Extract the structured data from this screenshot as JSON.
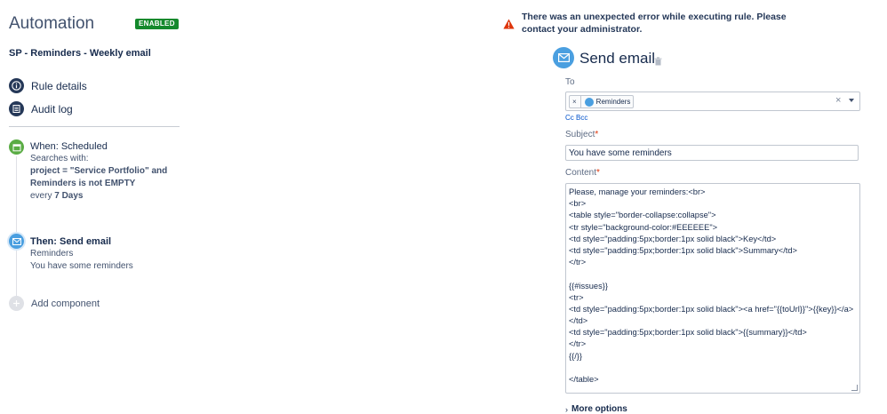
{
  "sidebar": {
    "title": "Automation",
    "status_badge": "ENABLED",
    "rule_name": "SP - Reminders - Weekly email",
    "nav": {
      "rule_details": "Rule details",
      "audit_log": "Audit log"
    },
    "trigger": {
      "title": "When: Scheduled",
      "searches_label": "Searches with:",
      "jql_line1": "project = \"Service Portfolio\" and",
      "jql_line2": "Reminders is not EMPTY",
      "every_prefix": "every",
      "every_value": "7 Days"
    },
    "action": {
      "title": "Then: Send email",
      "line1": "Reminders",
      "line2": "You have some reminders"
    },
    "add_component": "Add component"
  },
  "editor": {
    "error_message": "There was an unexpected error while executing rule. Please contact your administrator.",
    "title": "Send email",
    "to_label": "To",
    "to_recipient": "Reminders",
    "cc_bcc": "Cc Bcc",
    "subject_label": "Subject",
    "subject_value": "You have some reminders",
    "content_label": "Content",
    "required_mark": "*",
    "content_lines": [
      "Please, manage your reminders:<br>",
      "<br>",
      "<table style=\"border-collapse:collapse\">",
      "<tr style=\"background-color:#EEEEEE\">",
      "<td style=\"padding:5px;border:1px solid black\">Key</td>",
      "<td style=\"padding:5px;border:1px solid black\">Summary</td>",
      "</tr>",
      "",
      "{{#issues}}",
      "<tr>",
      "<td style=\"padding:5px;border:1px solid black\"><a href=\"{{toUrl}}\">{{key}}</a>",
      "</td>",
      "<td style=\"padding:5px;border:1px solid black\">{{summary}}</td>",
      "</tr>",
      "{{/}}",
      "",
      "</table>"
    ],
    "more_options": "More options"
  },
  "colors": {
    "enabled_badge": "#14892c",
    "error_icon": "#de350b",
    "send_email_icon": "#4a9fe0",
    "trigger_icon": "#5aac44",
    "nav_icon": "#253858",
    "required": "#de350b"
  },
  "icons": {
    "rule_details": "info-icon",
    "audit_log": "list-icon",
    "trigger": "calendar-icon",
    "action": "envelope-icon",
    "add": "plus-icon",
    "error": "warning-icon",
    "delete": "trash-icon"
  }
}
